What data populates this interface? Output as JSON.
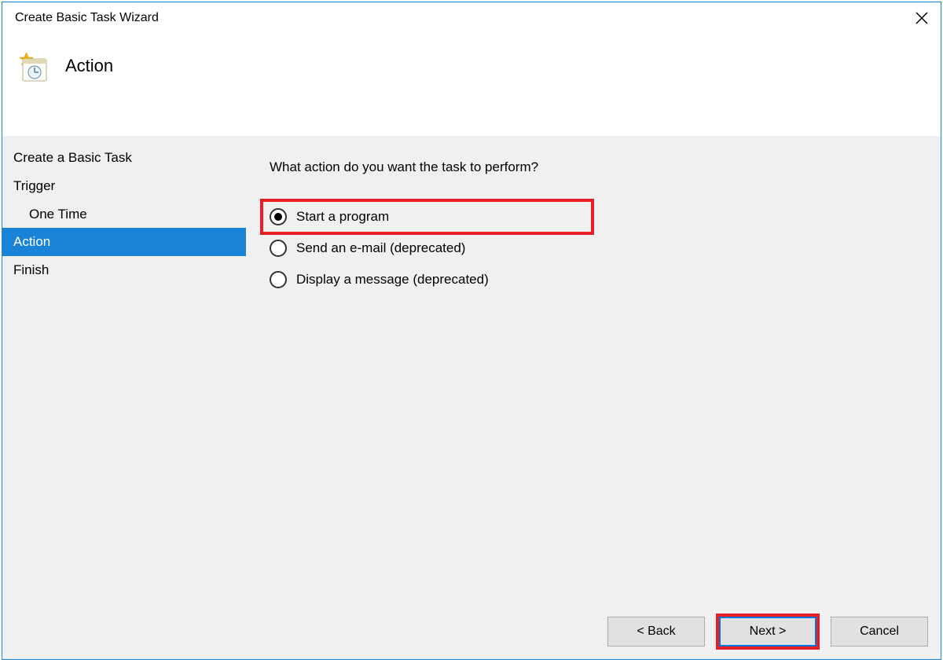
{
  "window": {
    "title": "Create Basic Task Wizard"
  },
  "header": {
    "title": "Action"
  },
  "sidebar": {
    "items": [
      {
        "label": "Create a Basic Task",
        "selected": false,
        "child": false
      },
      {
        "label": "Trigger",
        "selected": false,
        "child": false
      },
      {
        "label": "One Time",
        "selected": false,
        "child": true
      },
      {
        "label": "Action",
        "selected": true,
        "child": false
      },
      {
        "label": "Finish",
        "selected": false,
        "child": false
      }
    ]
  },
  "main": {
    "prompt": "What action do you want the task to perform?",
    "options": [
      {
        "label": "Start a program",
        "selected": true,
        "highlighted": true
      },
      {
        "label": "Send an e-mail (deprecated)",
        "selected": false,
        "highlighted": false
      },
      {
        "label": "Display a message (deprecated)",
        "selected": false,
        "highlighted": false
      }
    ]
  },
  "footer": {
    "back": "< Back",
    "next": "Next >",
    "cancel": "Cancel"
  }
}
